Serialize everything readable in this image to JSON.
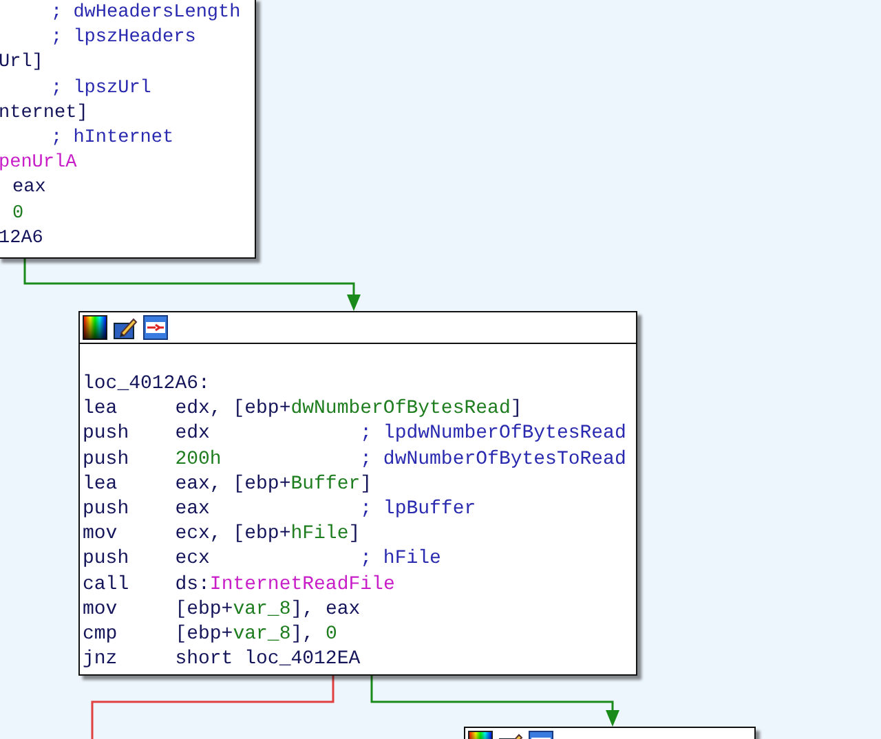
{
  "top_block": {
    "lines": [
      {
        "kind": "comment",
        "text": "; dwHeadersLength"
      },
      {
        "kind": "comment",
        "text": "; lpszHeaders"
      },
      {
        "kind": "code",
        "text": "Url]"
      },
      {
        "kind": "comment",
        "text": "; lpszUrl"
      },
      {
        "kind": "code",
        "text": "nternet]"
      },
      {
        "kind": "comment",
        "text": "; hInternet"
      },
      {
        "kind": "import",
        "text": "penUrlA"
      },
      {
        "kind": "operand",
        "text": "eax"
      },
      {
        "kind": "number",
        "text": "0"
      },
      {
        "kind": "code",
        "text": "12A6"
      }
    ]
  },
  "main_block": {
    "label": "loc_4012A6:",
    "rows": [
      {
        "mnemonic": "lea",
        "operand": [
          {
            "text": "edx, [ebp+",
            "kind": "plain"
          },
          {
            "text": "dwNumberOfBytesRead",
            "kind": "var"
          },
          {
            "text": "]",
            "kind": "plain"
          }
        ]
      },
      {
        "mnemonic": "push",
        "operand": [
          {
            "text": "edx",
            "kind": "plain"
          }
        ],
        "comment": "; lpdwNumberOfBytesRead"
      },
      {
        "mnemonic": "push",
        "operand": [
          {
            "text": "200h",
            "kind": "number"
          }
        ],
        "comment": "; dwNumberOfBytesToRead"
      },
      {
        "mnemonic": "lea",
        "operand": [
          {
            "text": "eax, [ebp+",
            "kind": "plain"
          },
          {
            "text": "Buffer",
            "kind": "var"
          },
          {
            "text": "]",
            "kind": "plain"
          }
        ]
      },
      {
        "mnemonic": "push",
        "operand": [
          {
            "text": "eax",
            "kind": "plain"
          }
        ],
        "comment": "; lpBuffer"
      },
      {
        "mnemonic": "mov",
        "operand": [
          {
            "text": "ecx, [ebp+",
            "kind": "plain"
          },
          {
            "text": "hFile",
            "kind": "var"
          },
          {
            "text": "]",
            "kind": "plain"
          }
        ]
      },
      {
        "mnemonic": "push",
        "operand": [
          {
            "text": "ecx",
            "kind": "plain"
          }
        ],
        "comment": "; hFile"
      },
      {
        "mnemonic": "call",
        "operand": [
          {
            "text": "ds:",
            "kind": "plain"
          },
          {
            "text": "InternetReadFile",
            "kind": "import"
          }
        ]
      },
      {
        "mnemonic": "mov",
        "operand": [
          {
            "text": "[ebp+",
            "kind": "plain"
          },
          {
            "text": "var_8",
            "kind": "var"
          },
          {
            "text": "], eax",
            "kind": "plain"
          }
        ]
      },
      {
        "mnemonic": "cmp",
        "operand": [
          {
            "text": "[ebp+",
            "kind": "plain"
          },
          {
            "text": "var_8",
            "kind": "var"
          },
          {
            "text": "], ",
            "kind": "plain"
          },
          {
            "text": "0",
            "kind": "number"
          }
        ]
      },
      {
        "mnemonic": "jnz",
        "operand": [
          {
            "text": "short loc_4012EA",
            "kind": "plain"
          }
        ]
      }
    ]
  },
  "edges": [
    {
      "kind": "taken"
    },
    {
      "kind": "not_taken"
    },
    {
      "kind": "taken"
    }
  ]
}
